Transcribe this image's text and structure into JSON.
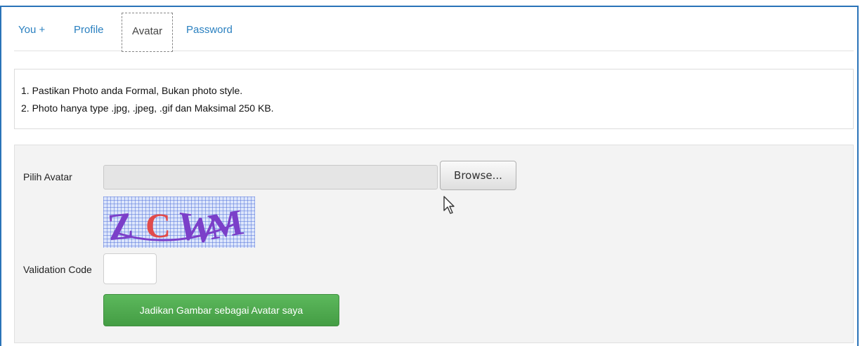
{
  "tabs": [
    {
      "label": "You +",
      "active": false
    },
    {
      "label": "Profile",
      "active": false
    },
    {
      "label": "Avatar",
      "active": true
    },
    {
      "label": "Password",
      "active": false
    }
  ],
  "notes": [
    "1.  Pastikan Photo anda Formal, Bukan photo style.",
    "2.  Photo hanya type .jpg, .jpeg, .gif dan Maksimal 250 KB."
  ],
  "form": {
    "avatar_label": "Pilih Avatar",
    "file_value": "",
    "browse_label": "Browse...",
    "captcha_text": "ZCWM",
    "validation_label": "Validation Code",
    "validation_value": "",
    "submit_label": "Jadikan Gambar sebagai Avatar saya"
  },
  "colors": {
    "frame_border": "#2a73b8",
    "tab_link": "#2a80c0",
    "submit_bg": "#5cb85c",
    "panel_bg": "#f3f3f3"
  },
  "icons": [
    "mouse-pointer-icon"
  ]
}
